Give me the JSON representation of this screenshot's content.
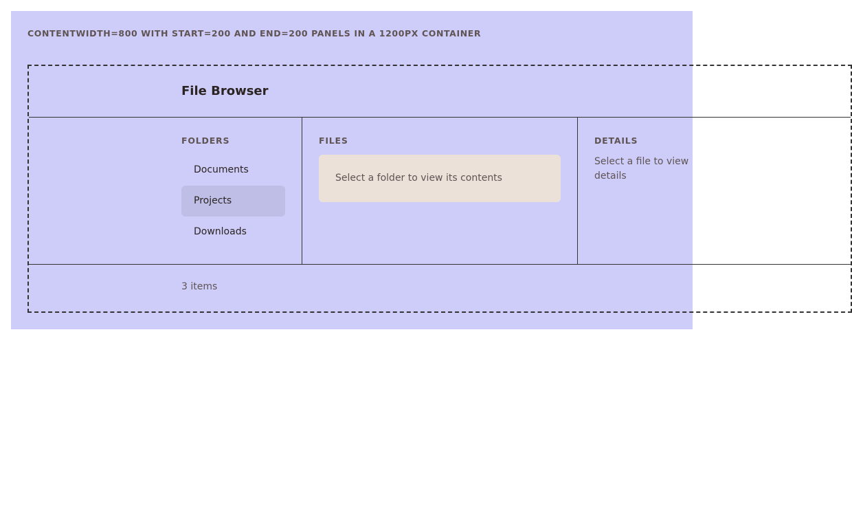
{
  "caption": "CONTENTWIDTH=800 WITH START=200 AND END=200 PANELS IN A 1200PX CONTAINER",
  "header": {
    "title": "File Browser"
  },
  "folders": {
    "label": "FOLDERS",
    "items": [
      {
        "label": "Documents",
        "selected": false
      },
      {
        "label": "Projects",
        "selected": true
      },
      {
        "label": "Downloads",
        "selected": false
      }
    ]
  },
  "files": {
    "label": "FILES",
    "empty_message": "Select a folder to view its contents"
  },
  "details": {
    "label": "DETAILS",
    "empty_message": "Select a file to view details"
  },
  "footer": {
    "status": "3 items"
  },
  "colors": {
    "stage_background": "#cecdf9",
    "selected_item_background": "#bebee6",
    "empty_box_background": "#ece1d8",
    "muted_text": "#5f5453",
    "primary_text": "#2b2422"
  }
}
